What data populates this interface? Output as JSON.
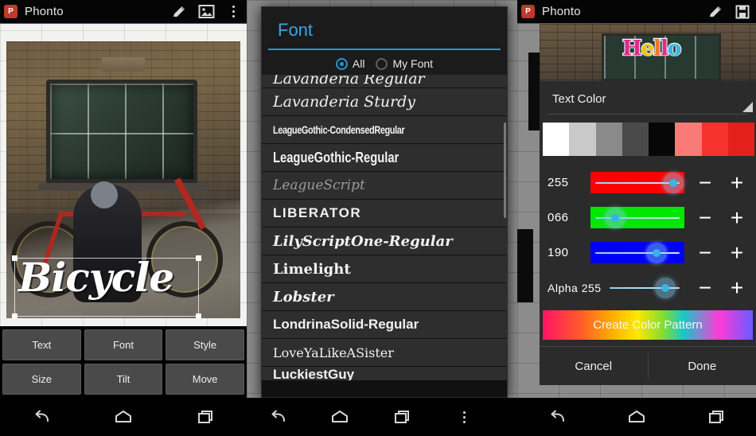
{
  "meta": {
    "accent_blue": "#2196d6",
    "panel_bg": "#2b2b2b",
    "dialog_bg": "#1b1b1b"
  },
  "panel1": {
    "actionbar": {
      "title": "Phonto",
      "icons": [
        "pencil-icon",
        "gallery-icon",
        "overflow-menu-icon"
      ]
    },
    "canvas": {
      "text_object": "Bicycle",
      "photo_description": "brick-wall-window-cyclist"
    },
    "tools": [
      {
        "label": "Text"
      },
      {
        "label": "Font"
      },
      {
        "label": "Style"
      },
      {
        "label": "Size"
      },
      {
        "label": "Tilt"
      },
      {
        "label": "Move"
      }
    ],
    "navbar": [
      "back-icon",
      "home-icon",
      "recents-icon"
    ]
  },
  "panel2": {
    "dialog": {
      "title": "Font",
      "filters": [
        {
          "label": "All",
          "selected": true
        },
        {
          "label": "My Font",
          "selected": false
        }
      ],
      "fonts": [
        {
          "name": "Lavanderia Regular",
          "style": "script",
          "partial": "top"
        },
        {
          "name": "Lavanderia Sturdy",
          "style": "script"
        },
        {
          "name": "LeagueGothic-CondensedRegular",
          "style": "condensed"
        },
        {
          "name": "LeagueGothic-Regular",
          "style": "gothic"
        },
        {
          "name": "LeagueScript",
          "style": "thin-script"
        },
        {
          "name": "LIBERATOR",
          "style": "slab"
        },
        {
          "name": "LilyScriptOne-Regular",
          "style": "bold-script"
        },
        {
          "name": "Limelight",
          "style": "bold-serif"
        },
        {
          "name": "Lobster",
          "style": "lobster"
        },
        {
          "name": "LondrinaSolid-Regular",
          "style": "solid"
        },
        {
          "name": "LoveYaLikeASister",
          "style": "plain"
        },
        {
          "name": "LuckiestGuy",
          "style": "solid",
          "partial": "bottom"
        }
      ]
    },
    "navbar": [
      "back-icon",
      "home-icon",
      "recents-icon",
      "overflow-menu-icon"
    ]
  },
  "panel3": {
    "actionbar": {
      "title": "Phonto",
      "icons": [
        "pencil-icon",
        "save-icon"
      ]
    },
    "preview": {
      "text": "Hello",
      "letters": [
        {
          "char": "H",
          "color": "#e8268e"
        },
        {
          "char": "e",
          "color": "#f5c400"
        },
        {
          "char": "l",
          "color": "#f07820"
        },
        {
          "char": "l",
          "color": "#e8268e"
        },
        {
          "char": "o",
          "color": "#2fb8e8"
        }
      ]
    },
    "dialog": {
      "title": "Text Color",
      "swatches": [
        "#ffffff",
        "#c9c9c9",
        "#8a8a8a",
        "#4a4a4a",
        "#070707",
        "#fa7a78",
        "#f6322f",
        "#e3201c"
      ],
      "sliders": [
        {
          "label": "255",
          "value": 255,
          "max": 255,
          "fill": "#ff0000",
          "name": "red-slider"
        },
        {
          "label": "066",
          "value": 66,
          "max": 255,
          "fill": "#00e800",
          "name": "green-slider"
        },
        {
          "label": "190",
          "value": 190,
          "max": 255,
          "fill": "#0000f0",
          "name": "blue-slider"
        },
        {
          "label": "Alpha 255",
          "value": 255,
          "max": 255,
          "fill": "transparent",
          "name": "alpha-slider"
        }
      ],
      "minus_label": "−",
      "plus_label": "+",
      "create_button": "Create Color Pattern",
      "cancel_button": "Cancel",
      "done_button": "Done"
    },
    "navbar": [
      "back-icon",
      "home-icon",
      "recents-icon"
    ]
  }
}
